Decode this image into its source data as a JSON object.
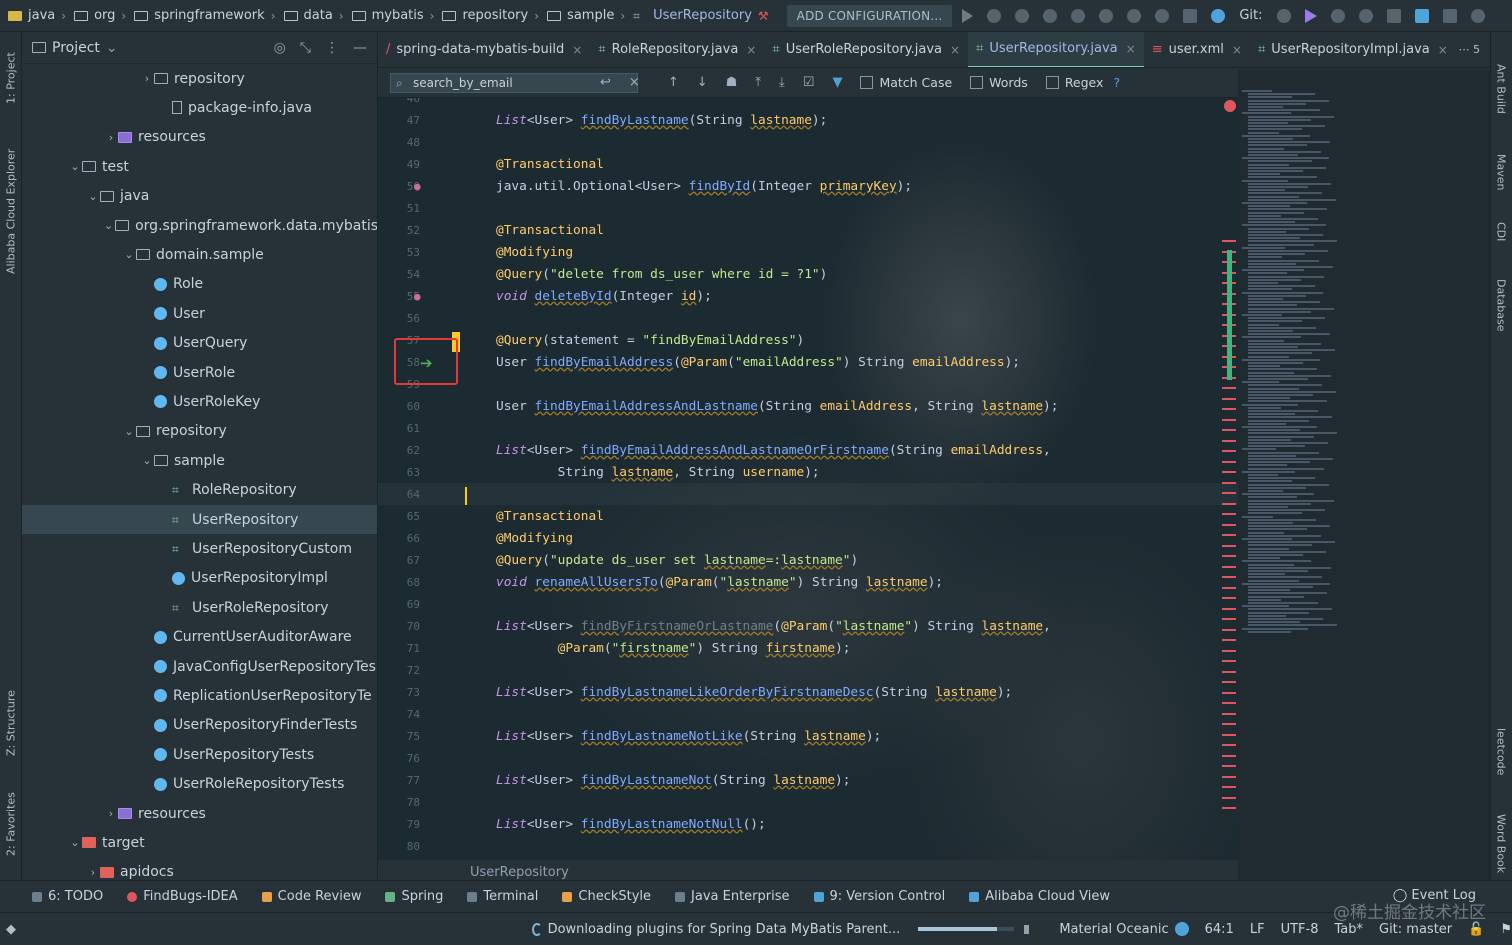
{
  "navbar": {
    "breadcrumbs": [
      "java",
      "org",
      "springframework",
      "data",
      "mybatis",
      "repository",
      "sample",
      "UserRepository"
    ],
    "add_config": "ADD CONFIGURATION...",
    "git_label": "Git:"
  },
  "project_panel": {
    "title": "Project",
    "tree": [
      {
        "label": "repository",
        "icon": "folder",
        "indent": 7,
        "arrow": "›"
      },
      {
        "label": "package-info.java",
        "icon": "file",
        "indent": 8,
        "arrow": ""
      },
      {
        "label": "resources",
        "icon": "folder-res",
        "indent": 5,
        "arrow": "›"
      },
      {
        "label": "test",
        "icon": "folder",
        "indent": 3,
        "arrow": "⌄"
      },
      {
        "label": "java",
        "icon": "folder",
        "indent": 4,
        "arrow": "⌄"
      },
      {
        "label": "org.springframework.data.mybatis",
        "icon": "folder",
        "indent": 5,
        "arrow": "⌄"
      },
      {
        "label": "domain.sample",
        "icon": "folder",
        "indent": 6,
        "arrow": "⌄"
      },
      {
        "label": "Role",
        "icon": "class",
        "indent": 7,
        "arrow": ""
      },
      {
        "label": "User",
        "icon": "class",
        "indent": 7,
        "arrow": ""
      },
      {
        "label": "UserQuery",
        "icon": "class",
        "indent": 7,
        "arrow": ""
      },
      {
        "label": "UserRole",
        "icon": "class",
        "indent": 7,
        "arrow": ""
      },
      {
        "label": "UserRoleKey",
        "icon": "class",
        "indent": 7,
        "arrow": ""
      },
      {
        "label": "repository",
        "icon": "folder",
        "indent": 6,
        "arrow": "⌄"
      },
      {
        "label": "sample",
        "icon": "folder",
        "indent": 7,
        "arrow": "⌄"
      },
      {
        "label": "RoleRepository",
        "icon": "iface",
        "indent": 8,
        "arrow": ""
      },
      {
        "label": "UserRepository",
        "icon": "iface",
        "indent": 8,
        "arrow": "",
        "selected": true
      },
      {
        "label": "UserRepositoryCustom",
        "icon": "iface",
        "indent": 8,
        "arrow": ""
      },
      {
        "label": "UserRepositoryImpl",
        "icon": "class",
        "indent": 8,
        "arrow": ""
      },
      {
        "label": "UserRoleRepository",
        "icon": "iface",
        "indent": 8,
        "arrow": ""
      },
      {
        "label": "CurrentUserAuditorAware",
        "icon": "class",
        "indent": 7,
        "arrow": ""
      },
      {
        "label": "JavaConfigUserRepositoryTes",
        "icon": "class",
        "indent": 7,
        "arrow": ""
      },
      {
        "label": "ReplicationUserRepositoryTe",
        "icon": "class",
        "indent": 7,
        "arrow": ""
      },
      {
        "label": "UserRepositoryFinderTests",
        "icon": "class",
        "indent": 7,
        "arrow": ""
      },
      {
        "label": "UserRepositoryTests",
        "icon": "class",
        "indent": 7,
        "arrow": ""
      },
      {
        "label": "UserRoleRepositoryTests",
        "icon": "class",
        "indent": 7,
        "arrow": ""
      },
      {
        "label": "resources",
        "icon": "folder-res",
        "indent": 5,
        "arrow": "›"
      },
      {
        "label": "target",
        "icon": "folder-red",
        "indent": 3,
        "arrow": "⌄"
      },
      {
        "label": "apidocs",
        "icon": "folder-red",
        "indent": 4,
        "arrow": "›"
      }
    ]
  },
  "tabs": [
    {
      "label": "spring-data-mybatis-build",
      "active": false
    },
    {
      "label": "RoleRepository.java",
      "active": false
    },
    {
      "label": "UserRoleRepository.java",
      "active": false
    },
    {
      "label": "UserRepository.java",
      "active": true
    },
    {
      "label": "user.xml",
      "active": false
    },
    {
      "label": "UserRepositoryImpl.java",
      "active": false
    }
  ],
  "tabs_overflow": "5",
  "findbar": {
    "query": "search_by_email",
    "match_case": "Match Case",
    "words": "Words",
    "regex": "Regex",
    "help": "?"
  },
  "editor": {
    "lines": [
      {
        "n": "46",
        "html": ""
      },
      {
        "n": "47",
        "html": "<span class='kw'>List</span>&lt;User&gt; <span class='fn sq'>findByLastname</span>(String <span class='ty sq'>lastname</span>);"
      },
      {
        "n": "48",
        "html": ""
      },
      {
        "n": "49",
        "html": "<span class='ann'>@Transactional</span>"
      },
      {
        "n": "50",
        "html": "java.util.Optional&lt;User&gt; <span class='fn sq'>findById</span>(Integer <span class='ty sq'>primaryKey</span>);"
      },
      {
        "n": "51",
        "html": ""
      },
      {
        "n": "52",
        "html": "<span class='ann'>@Transactional</span>"
      },
      {
        "n": "53",
        "html": "<span class='ann'>@Modifying</span>"
      },
      {
        "n": "54",
        "html": "<span class='ann'>@Query</span>(<span class='str'>\"delete from ds_user where id = ?1\"</span>)"
      },
      {
        "n": "55",
        "html": "<span class='kw'>void</span> <span class='fn sq'>deleteById</span>(Integer <span class='ty sq'>id</span>);"
      },
      {
        "n": "56",
        "html": ""
      },
      {
        "n": "57",
        "html": "<span class='ann'>@Query</span>(statement = <span class='str'>\"findByEmailAddress\"</span>)"
      },
      {
        "n": "58",
        "html": "User <span class='fn sq'>findByEmailAddress</span>(<span class='ann'>@Param</span>(<span class='str'>\"emailAddress\"</span>) String <span class='ty'>emailAddress</span>);"
      },
      {
        "n": "59",
        "html": ""
      },
      {
        "n": "60",
        "html": "User <span class='fn sq'>findByEmailAddressAndLastname</span>(String <span class='ty'>emailAddress</span>, String <span class='ty sq'>lastname</span>);"
      },
      {
        "n": "61",
        "html": ""
      },
      {
        "n": "62",
        "html": "<span class='kw'>List</span>&lt;User&gt; <span class='fn sq'>findByEmailAddressAndLastnameOrFirstname</span>(String <span class='ty'>emailAddress</span>,"
      },
      {
        "n": "63",
        "html": "        String <span class='ty sq'>lastname</span>, String <span class='ty'>username</span>);"
      },
      {
        "n": "64",
        "html": ""
      },
      {
        "n": "65",
        "html": "<span class='ann'>@Transactional</span>"
      },
      {
        "n": "66",
        "html": "<span class='ann'>@Modifying</span>"
      },
      {
        "n": "67",
        "html": "<span class='ann'>@Query</span>(<span class='str'>\"update ds_user set <span class='sq'>lastname</span>=:<span class='sq'>lastname</span>\"</span>)"
      },
      {
        "n": "68",
        "html": "<span class='kw'>void</span> <span class='fn sq'>renameAllUsersTo</span>(<span class='ann'>@Param</span>(<span class='str'>\"<span class='sq'>lastname</span>\"</span>) String <span class='ty sq'>lastname</span>);"
      },
      {
        "n": "69",
        "html": ""
      },
      {
        "n": "70",
        "html": "<span class='kw'>List</span>&lt;User&gt; <span class='sq' style='color:#6f7f8c'>findByFirstnameOrLastname</span>(<span class='ann'>@Param</span>(<span class='str'>\"<span class='sq'>lastname</span>\"</span>) String <span class='ty sq'>lastname</span>,"
      },
      {
        "n": "71",
        "html": "        <span class='ann'>@Param</span>(<span class='str'>\"<span class='sq'>firstname</span>\"</span>) String <span class='ty sq'>firstname</span>);"
      },
      {
        "n": "72",
        "html": ""
      },
      {
        "n": "73",
        "html": "<span class='kw'>List</span>&lt;User&gt; <span class='fn sq'>findByLastnameLikeOrderByFirstnameDesc</span>(String <span class='ty sq'>lastname</span>);"
      },
      {
        "n": "74",
        "html": ""
      },
      {
        "n": "75",
        "html": "<span class='kw'>List</span>&lt;User&gt; <span class='fn sq'>findByLastnameNotLike</span>(String <span class='ty sq'>lastname</span>);"
      },
      {
        "n": "76",
        "html": ""
      },
      {
        "n": "77",
        "html": "<span class='kw'>List</span>&lt;User&gt; <span class='fn sq'>findByLastnameNot</span>(String <span class='ty sq'>lastname</span>);"
      },
      {
        "n": "78",
        "html": ""
      },
      {
        "n": "79",
        "html": "<span class='kw'>List</span>&lt;User&gt; <span class='fn sq'>findByLastnameNotNull</span>();"
      },
      {
        "n": "80",
        "html": ""
      }
    ],
    "current_line": "64",
    "footer": "UserRepository"
  },
  "left_strip": [
    "1: Project",
    "Alibaba Cloud Explorer",
    "Z: Structure",
    "2: Favorites"
  ],
  "right_strip": [
    "Ant Build",
    "Maven",
    "CDI",
    "Database",
    "leetcode",
    "Word Book"
  ],
  "bottom_tools": [
    {
      "label": "6: TODO",
      "dot": ""
    },
    {
      "label": "FindBugs-IDEA",
      "dot": "red"
    },
    {
      "label": "Code Review",
      "dot": "orange"
    },
    {
      "label": "Spring",
      "dot": "green"
    },
    {
      "label": "Terminal",
      "dot": ""
    },
    {
      "label": "CheckStyle",
      "dot": "orange"
    },
    {
      "label": "Java Enterprise",
      "dot": ""
    },
    {
      "label": "9: Version Control",
      "dot": "blue"
    },
    {
      "label": "Alibaba Cloud View",
      "dot": "blue"
    }
  ],
  "event_log": "Event Log",
  "status": {
    "downloading": "Downloading plugins for Spring Data MyBatis Parent...",
    "progress_fraction": 0.82,
    "theme": "Material Oceanic",
    "position": "64:1",
    "line_sep": "LF",
    "encoding": "UTF-8",
    "indent": "Tab*",
    "git_branch": "Git: master"
  },
  "watermark": "@稀土掘金技术社区"
}
